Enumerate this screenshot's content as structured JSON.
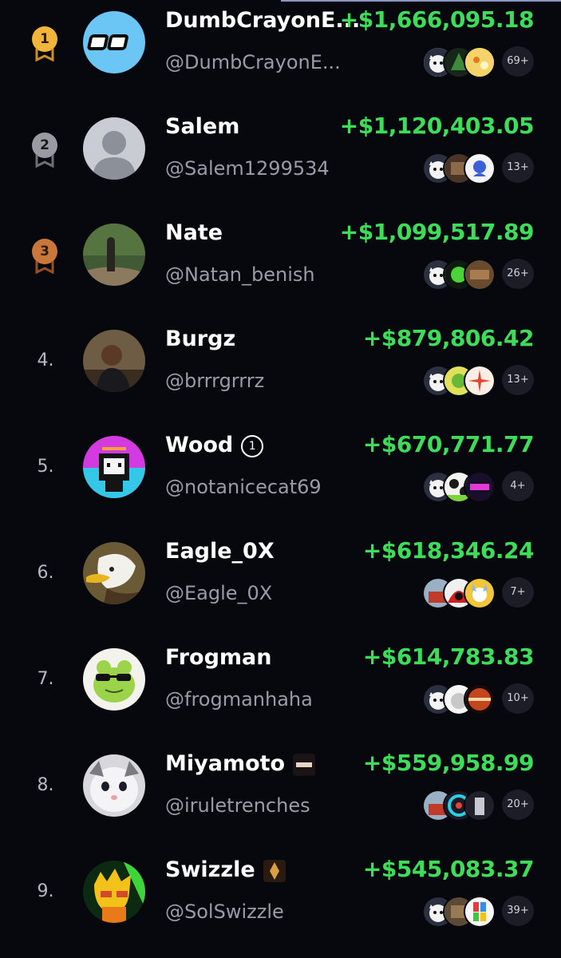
{
  "leaderboard": [
    {
      "rank": "1",
      "name": "DumbCrayonE...",
      "handle": "@DumbCrayonE...",
      "pnl": "+$1,666,095.18",
      "extra_tokens": "69+"
    },
    {
      "rank": "2",
      "name": "Salem",
      "handle": "@Salem1299534",
      "pnl": "+$1,120,403.05",
      "extra_tokens": "13+"
    },
    {
      "rank": "3",
      "name": "Nate",
      "handle": "@Natan_benish",
      "pnl": "+$1,099,517.89",
      "extra_tokens": "26+"
    },
    {
      "rank": "4.",
      "name": "Burgz",
      "handle": "@brrrgrrrz",
      "pnl": "+$879,806.42",
      "extra_tokens": "13+"
    },
    {
      "rank": "5.",
      "name": "Wood",
      "handle": "@notanicecat69",
      "pnl": "+$670,771.77",
      "extra_tokens": "4+",
      "badge": "1"
    },
    {
      "rank": "6.",
      "name": "Eagle_0X",
      "handle": "@Eagle_0X",
      "pnl": "+$618,346.24",
      "extra_tokens": "7+"
    },
    {
      "rank": "7.",
      "name": "Frogman",
      "handle": "@frogmanhaha",
      "pnl": "+$614,783.83",
      "extra_tokens": "10+"
    },
    {
      "rank": "8.",
      "name": "Miyamoto",
      "handle": "@iruletrenches",
      "pnl": "+$559,958.99",
      "extra_tokens": "20+"
    },
    {
      "rank": "9.",
      "name": "Swizzle",
      "handle": "@SolSwizzle",
      "pnl": "+$545,083.37",
      "extra_tokens": "39+"
    }
  ],
  "colors": {
    "background": "#07070e",
    "profit": "#3ddc59",
    "handle": "#9b9ba8",
    "gold": "#f0b53a",
    "silver": "#9a9aa2",
    "bronze": "#c9773a"
  },
  "icons": {
    "medal": "medal-icon",
    "verified_badge": "circle-number-badge"
  }
}
